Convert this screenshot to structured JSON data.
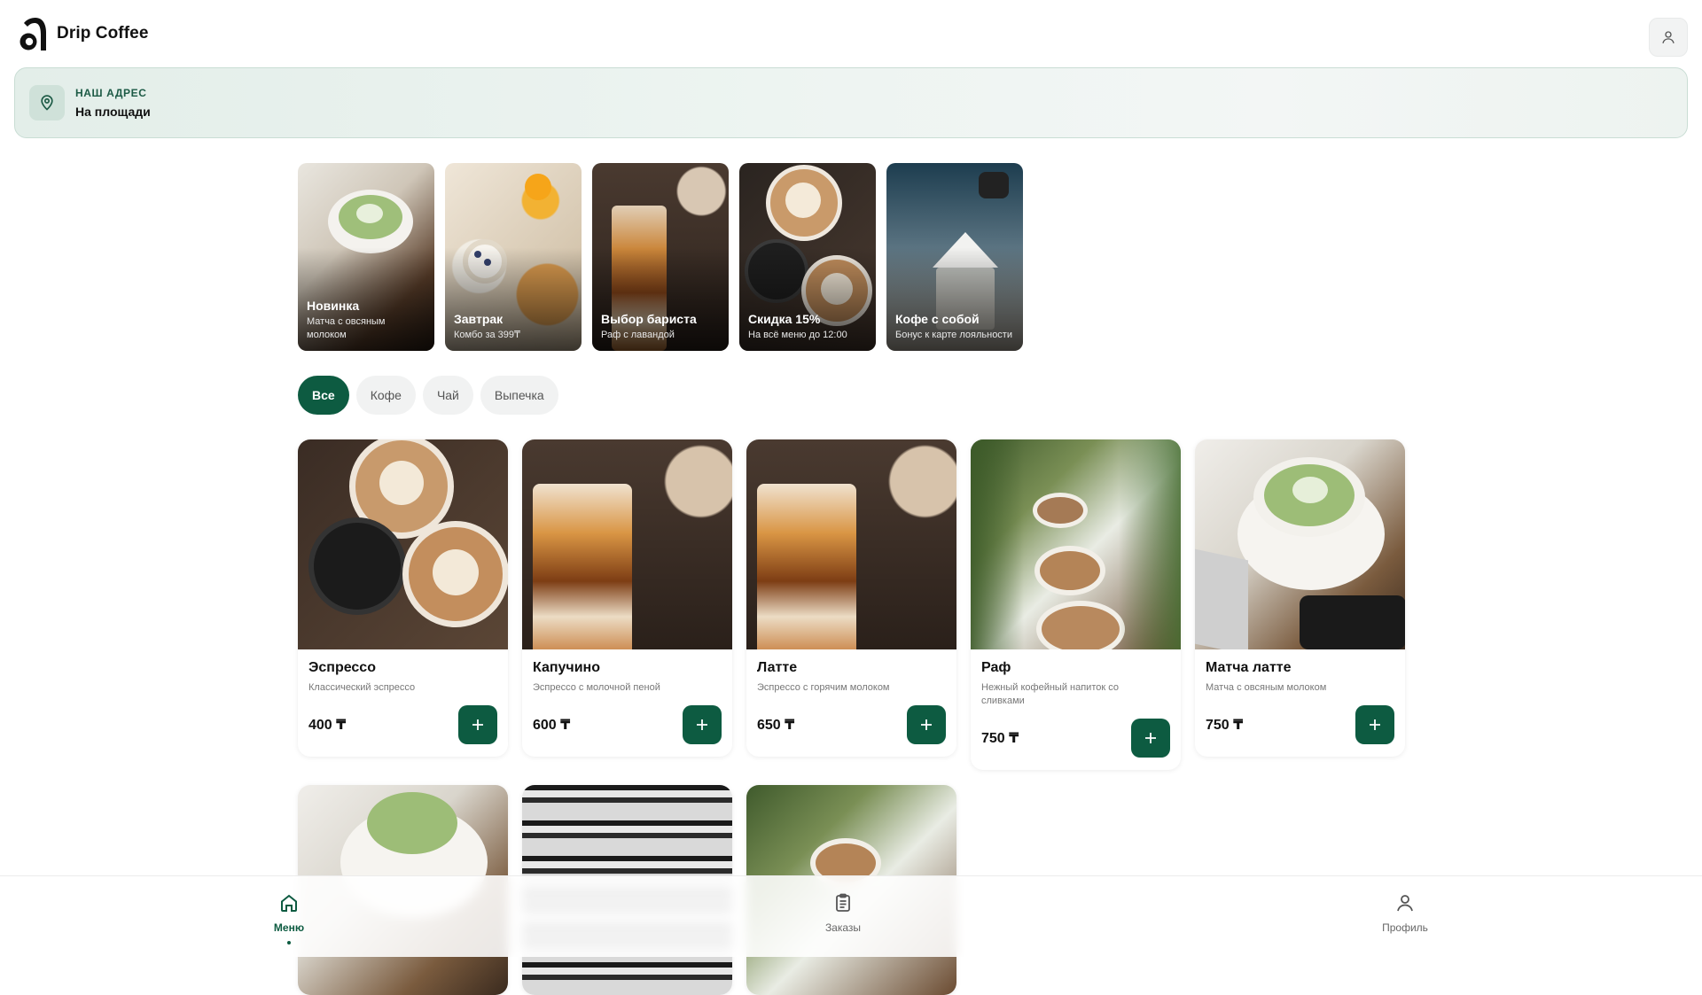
{
  "header": {
    "brand": "Drip Coffee"
  },
  "address": {
    "label": "НАШ АДРЕС",
    "value": "На площади"
  },
  "promos": [
    {
      "title": "Новинка",
      "subtitle": "Матча с овсяным молоком"
    },
    {
      "title": "Завтрак",
      "subtitle": "Комбо за 399₸"
    },
    {
      "title": "Выбор бариста",
      "subtitle": "Раф с лавандой"
    },
    {
      "title": "Скидка 15%",
      "subtitle": "На всё меню до 12:00"
    },
    {
      "title": "Кофе с собой",
      "subtitle": "Бонус к карте лояльности"
    }
  ],
  "categories": [
    "Все",
    "Кофе",
    "Чай",
    "Выпечка"
  ],
  "products": [
    {
      "name": "Эспрессо",
      "description": "Классический эспрессо",
      "price": "400 ₸"
    },
    {
      "name": "Капучино",
      "description": "Эспрессо с молочной пеной",
      "price": "600 ₸"
    },
    {
      "name": "Латте",
      "description": "Эспрессо с горячим молоком",
      "price": "650 ₸"
    },
    {
      "name": "Раф",
      "description": "Нежный кофейный напиток со сливками",
      "price": "750 ₸"
    },
    {
      "name": "Матча латте",
      "description": "Матча с овсяным молоком",
      "price": "750 ₸"
    }
  ],
  "nav": {
    "menu": "Меню",
    "orders": "Заказы",
    "profile": "Профиль"
  },
  "colors": {
    "accent": "#0d5b41",
    "address_bg": "#e6f0ec"
  },
  "icons": {
    "logo": "drip-logo",
    "profile": "user-icon",
    "address": "map-pin-icon",
    "add": "plus-icon",
    "menu": "home-icon",
    "orders": "clipboard-icon"
  }
}
